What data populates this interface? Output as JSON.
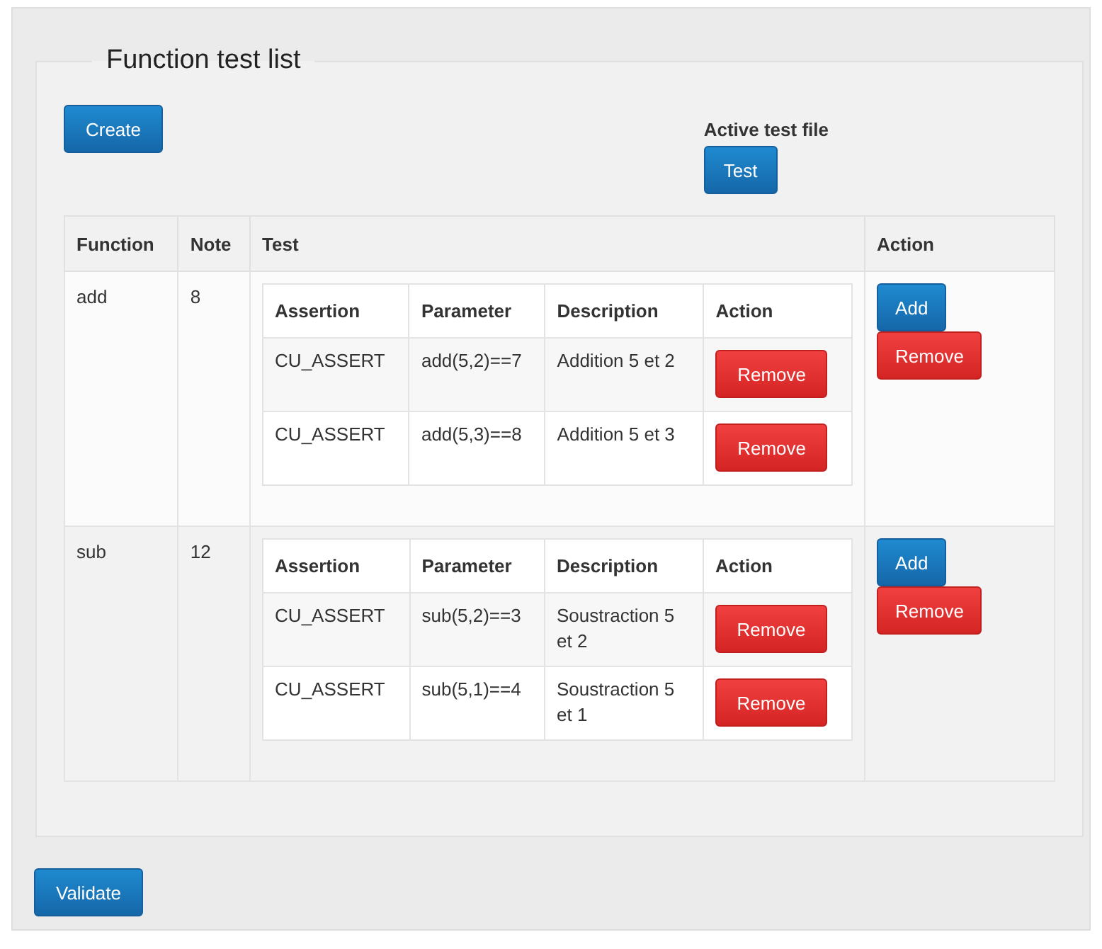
{
  "legend": "Function test list",
  "create_button": "Create",
  "active_test_file": {
    "label": "Active test file",
    "button": "Test"
  },
  "table": {
    "columns": [
      "Function",
      "Note",
      "Test",
      "Action"
    ],
    "rows": [
      {
        "function": "add",
        "note": "8",
        "tests": {
          "columns": [
            "Assertion",
            "Parameter",
            "Description",
            "Action"
          ],
          "rows": [
            {
              "assertion": "CU_ASSERT",
              "parameter": "add(5,2)==7",
              "description": "Addition 5 et 2",
              "action": "Remove"
            },
            {
              "assertion": "CU_ASSERT",
              "parameter": "add(5,3)==8",
              "description": "Addition 5 et 3",
              "action": "Remove"
            }
          ]
        },
        "actions": [
          {
            "label": "Add",
            "kind": "primary"
          },
          {
            "label": "Remove",
            "kind": "danger"
          }
        ]
      },
      {
        "function": "sub",
        "note": "12",
        "tests": {
          "columns": [
            "Assertion",
            "Parameter",
            "Description",
            "Action"
          ],
          "rows": [
            {
              "assertion": "CU_ASSERT",
              "parameter": "sub(5,2)==3",
              "description": "Soustraction 5 et 2",
              "action": "Remove"
            },
            {
              "assertion": "CU_ASSERT",
              "parameter": "sub(5,1)==4",
              "description": "Soustraction 5 et 1",
              "action": "Remove"
            }
          ]
        },
        "actions": [
          {
            "label": "Add",
            "kind": "primary"
          },
          {
            "label": "Remove",
            "kind": "danger"
          }
        ]
      }
    ]
  },
  "validate_button": "Validate"
}
